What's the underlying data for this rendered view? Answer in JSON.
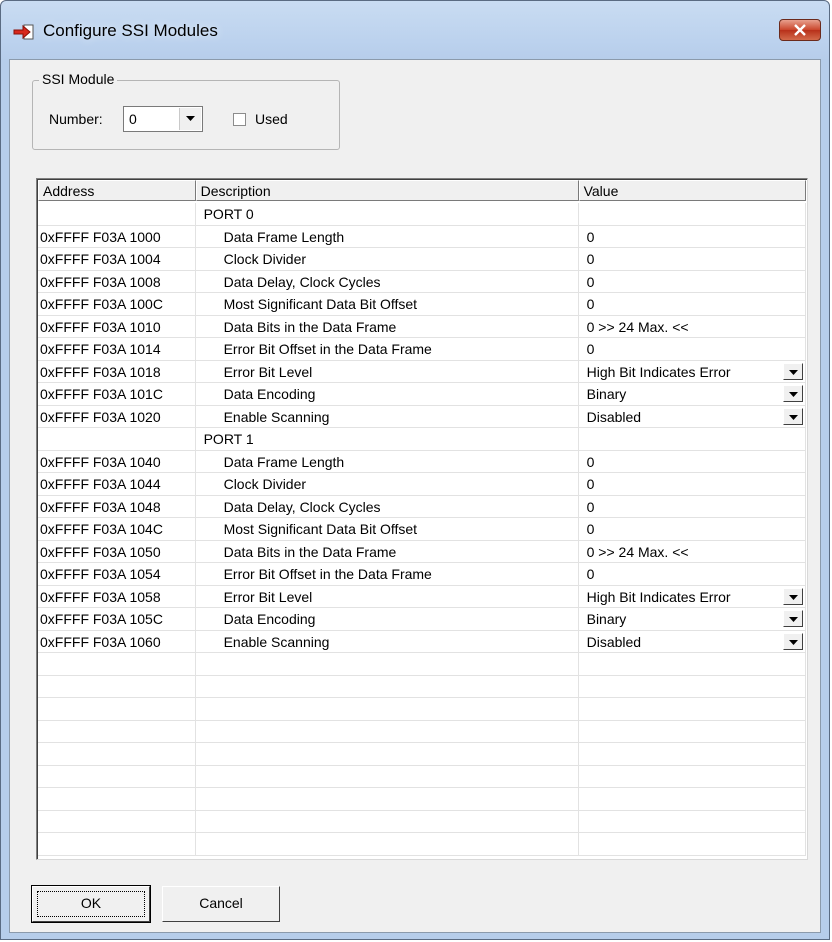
{
  "window": {
    "title": "Configure SSI Modules"
  },
  "module_group": {
    "label": "SSI Module",
    "number_label": "Number:",
    "number_value": "0",
    "used_label": "Used",
    "used_checked": false
  },
  "grid": {
    "columns": [
      "Address",
      "Description",
      "Value"
    ],
    "rows": [
      {
        "addr": "",
        "desc": "PORT 0",
        "value": "",
        "port": true
      },
      {
        "addr": "0xFFFF F03A 1000",
        "desc": "Data Frame Length",
        "value": "0"
      },
      {
        "addr": "0xFFFF F03A 1004",
        "desc": "Clock Divider",
        "value": "0"
      },
      {
        "addr": "0xFFFF F03A 1008",
        "desc": "Data Delay, Clock Cycles",
        "value": "0"
      },
      {
        "addr": "0xFFFF F03A 100C",
        "desc": "Most Significant Data Bit Offset",
        "value": "0"
      },
      {
        "addr": "0xFFFF F03A 1010",
        "desc": "Data Bits in the Data Frame",
        "value": "0   >> 24 Max. <<"
      },
      {
        "addr": "0xFFFF F03A 1014",
        "desc": "Error Bit Offset in the Data Frame",
        "value": "0"
      },
      {
        "addr": "0xFFFF F03A 1018",
        "desc": "Error Bit Level",
        "value": "High Bit Indicates Error",
        "dropdown": true
      },
      {
        "addr": "0xFFFF F03A 101C",
        "desc": "Data Encoding",
        "value": "Binary",
        "dropdown": true
      },
      {
        "addr": "0xFFFF F03A 1020",
        "desc": "Enable Scanning",
        "value": "Disabled",
        "dropdown": true
      },
      {
        "addr": "",
        "desc": "PORT 1",
        "value": "",
        "port": true
      },
      {
        "addr": "0xFFFF F03A 1040",
        "desc": "Data Frame Length",
        "value": "0"
      },
      {
        "addr": "0xFFFF F03A 1044",
        "desc": "Clock Divider",
        "value": "0"
      },
      {
        "addr": "0xFFFF F03A 1048",
        "desc": "Data Delay, Clock Cycles",
        "value": "0"
      },
      {
        "addr": "0xFFFF F03A 104C",
        "desc": "Most Significant Data Bit Offset",
        "value": "0"
      },
      {
        "addr": "0xFFFF F03A 1050",
        "desc": "Data Bits in the Data Frame",
        "value": "0   >> 24 Max. <<"
      },
      {
        "addr": "0xFFFF F03A 1054",
        "desc": "Error Bit Offset in the Data Frame",
        "value": "0"
      },
      {
        "addr": "0xFFFF F03A 1058",
        "desc": "Error Bit Level",
        "value": "High Bit Indicates Error",
        "dropdown": true
      },
      {
        "addr": "0xFFFF F03A 105C",
        "desc": "Data Encoding",
        "value": "Binary",
        "dropdown": true
      },
      {
        "addr": "0xFFFF F03A 1060",
        "desc": "Enable Scanning",
        "value": "Disabled",
        "dropdown": true
      }
    ],
    "empty_rows": 9
  },
  "buttons": {
    "ok": "OK",
    "cancel": "Cancel"
  },
  "colors": {
    "titlebar": "#bcd2ee",
    "close": "#c9452b",
    "dialog": "#f0f0f0"
  }
}
